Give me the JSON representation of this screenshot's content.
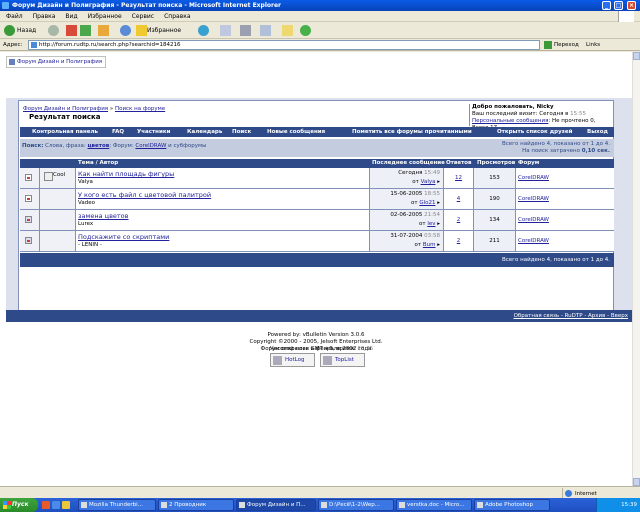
{
  "window": {
    "title": "Форум Дизайн и Полиграфия - Результат поиска - Microsoft Internet Explorer",
    "controls": [
      "_",
      "□",
      "×"
    ]
  },
  "menu": [
    "Файл",
    "Правка",
    "Вид",
    "Избранное",
    "Сервис",
    "Справка"
  ],
  "toolbar": {
    "back": "Назад",
    "favorites": "Избранное"
  },
  "address": {
    "label": "Адрес:",
    "url": "http://forum.rudtp.ru/search.php?searchid=184216",
    "go": "Переход",
    "links": "Links"
  },
  "forum": {
    "top_logo": "Форум Дизайн и Полиграфия",
    "breadcrumb_home": "Форум Дизайн и Полиграфия",
    "breadcrumb_sep": " » ",
    "breadcrumb_search": "Поиск на форуме",
    "page_title": "Результат поиска",
    "welcome": "Добро пожаловать, Nicky",
    "last_visit_label": "Ваш последний визит: Сегодня в",
    "last_visit_time": "15:55",
    "pm_link": "Персональные сообщения",
    "pm_text": ": Не прочтено 0, Всего 17.",
    "nav": [
      "Контрольная панель",
      "FAQ",
      "Участники",
      "Календарь",
      "Поиск",
      "Новые сообщения",
      "Пометить все форумы прочитанными",
      "Открыть список друзей",
      "Выход"
    ],
    "search_label": "Поиск:",
    "search_desc_prefix": " Слова, фраза: ",
    "search_phrase": "цветов",
    "search_desc_mid": "; Форум: ",
    "search_forum": "CorelDRAW",
    "search_desc_suffix": " и субфорумы",
    "summary_found": "Всего найдено 4, показано от 1 до 4.",
    "summary_time_label": "На поиск затрачено",
    "summary_time": "0,10 сек.",
    "columns": [
      "Тема / Автор",
      "Последнее сообщение",
      "Ответов",
      "Просмотров",
      "Форум"
    ],
    "threads": [
      {
        "icon_label": "Cool",
        "title": "Как найти площадь фигуры",
        "author": "Valya",
        "date": "Сегодня",
        "time": "15:49",
        "by_label": "от",
        "last_by": "Valya",
        "replies": "12",
        "views": "153",
        "forum": "CorelDRAW"
      },
      {
        "icon_label": "",
        "title": "У кого есть файл с цветовой палитрой",
        "author": "Vadeo",
        "date": "15-06-2005",
        "time": "18:55",
        "by_label": "от",
        "last_by": "Glo21",
        "replies": "4",
        "views": "190",
        "forum": "CorelDRAW"
      },
      {
        "icon_label": "",
        "title": "замена цветов",
        "author": "Lurex",
        "date": "02-06-2005",
        "time": "21:54",
        "by_label": "от",
        "last_by": "lev",
        "replies": "2",
        "views": "134",
        "forum": "CorelDRAW"
      },
      {
        "icon_label": "",
        "title": "Подскажите со скриптами",
        "author": "- LENIN -",
        "date": "31-07-2004",
        "time": "03:58",
        "by_label": "от",
        "last_by": "Bum",
        "replies": "2",
        "views": "211",
        "forum": "CorelDRAW"
      }
    ],
    "footer_summary": "Всего найдено 4, показано от 1 до 4.",
    "timezone_label": "Часовой пояс GMT +6, время:",
    "timezone_time": "18:35",
    "footer_links": "Обратная связь - RuDTP - Архив - Вверх",
    "credits": [
      "Powered by: vBulletin Version 3.0.6",
      "Copyright ©2000 - 2005, Jelsoft Enterprises Ltd.",
      "Форум открылся в феврале 2002 года"
    ],
    "counters": [
      "HotLog",
      "TopList"
    ]
  },
  "statusbar": {
    "zone": "Internet"
  },
  "taskbar": {
    "start": "Пуск",
    "tasks": [
      "Mozilla Thunderbi...",
      "2 Проводник",
      "Форум Дизайн и П...",
      "D:\\Ресё\\1-2\\Wep...",
      "verstka.doc - Micro...",
      "Adobe Photoshop"
    ],
    "clock": "15:39"
  },
  "colors": {
    "nav_bg": "#2f4a88",
    "link": "#22229c",
    "xp_blue": "#0a5ce8",
    "start_green": "#3da53d"
  }
}
